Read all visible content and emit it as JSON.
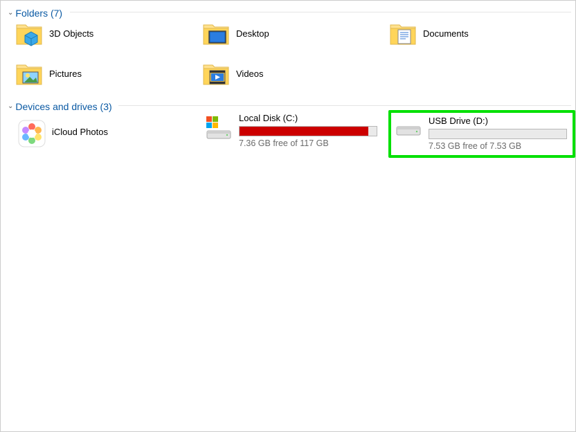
{
  "sections": {
    "folders": {
      "title": "Folders (7)"
    },
    "drives": {
      "title": "Devices and drives (3)"
    }
  },
  "folders": [
    {
      "name": "3D Objects",
      "key": "3d-objects"
    },
    {
      "name": "Desktop",
      "key": "desktop"
    },
    {
      "name": "Documents",
      "key": "documents"
    },
    {
      "name": "Pictures",
      "key": "pictures"
    },
    {
      "name": "Videos",
      "key": "videos"
    }
  ],
  "drives": [
    {
      "name": "iCloud Photos",
      "key": "icloud-photos",
      "type": "app",
      "status": "",
      "fill_pct": 0,
      "fill_color": ""
    },
    {
      "name": "Local Disk (C:)",
      "key": "local-disk-c",
      "type": "disk",
      "status": "7.36 GB free of 117 GB",
      "fill_pct": 94,
      "fill_color": "#cc0000"
    },
    {
      "name": "USB Drive (D:)",
      "key": "usb-drive-d",
      "type": "disk",
      "status": "7.53 GB free of 7.53 GB",
      "fill_pct": 0,
      "fill_color": "#26a0da",
      "highlighted": true
    }
  ]
}
